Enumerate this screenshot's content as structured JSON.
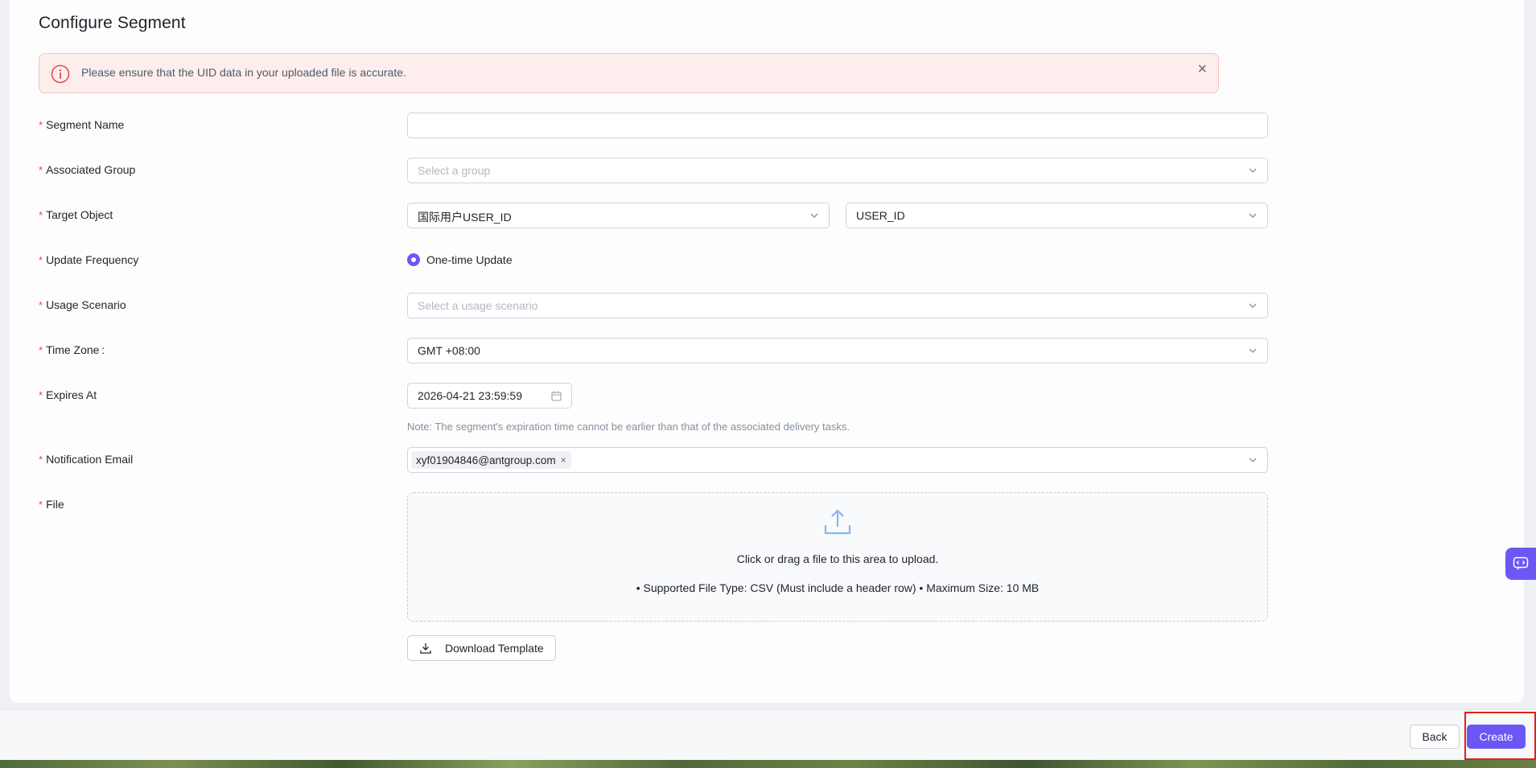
{
  "page": {
    "title": "Configure Segment"
  },
  "alert": {
    "message": "Please ensure that the UID data in your uploaded file is accurate.",
    "close": "×"
  },
  "form": {
    "required_mark": "*",
    "segment_name": {
      "label": "Segment Name",
      "value": ""
    },
    "associated_group": {
      "label": "Associated Group",
      "placeholder": "Select a group"
    },
    "target_object": {
      "label": "Target Object",
      "value_1": "国际用户USER_ID",
      "value_2": "USER_ID"
    },
    "update_frequency": {
      "label": "Update Frequency",
      "option": "One-time Update"
    },
    "usage_scenario": {
      "label": "Usage Scenario",
      "placeholder": "Select a usage scenario"
    },
    "time_zone": {
      "label": "Time Zone :",
      "value": "GMT +08:00"
    },
    "expires_at": {
      "label": "Expires At",
      "value": "2026-04-21 23:59:59",
      "note": "Note: The segment's expiration time cannot be earlier than that of the associated delivery tasks."
    },
    "notification_email": {
      "label": "Notification Email",
      "tag": "xyf01904846@antgroup.com",
      "tag_remove": "×"
    },
    "file": {
      "label": "File",
      "upload_main": "Click or drag a file to this area to upload.",
      "upload_sub": "• Supported File Type: CSV (Must include a header row) • Maximum Size: 10 MB",
      "download_template": "Download Template"
    }
  },
  "footer": {
    "back": "Back",
    "create": "Create"
  },
  "colors": {
    "accent": "#6c57f5",
    "alert_bg": "#fdeeed",
    "required": "#e5484d",
    "highlight": "#e0201b"
  }
}
